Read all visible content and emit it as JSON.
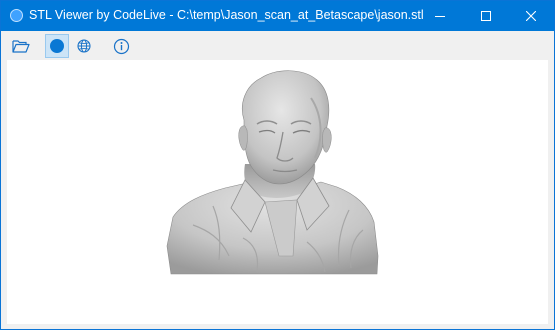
{
  "window": {
    "title": "STL Viewer by CodeLive - C:\\temp\\Jason_scan_at_Betascape\\jason.stl",
    "controls": [
      {
        "name": "minimize",
        "icon": "minimize-icon"
      },
      {
        "name": "maximize",
        "icon": "maximize-icon"
      },
      {
        "name": "close",
        "icon": "close-icon"
      }
    ]
  },
  "toolbar": {
    "buttons": [
      {
        "name": "open-file",
        "icon": "folder-open-icon"
      },
      {
        "name": "solid-view",
        "icon": "solid-sphere-icon",
        "active": true
      },
      {
        "name": "wireframe-view",
        "icon": "wireframe-globe-icon"
      },
      {
        "name": "about",
        "icon": "info-icon"
      }
    ]
  },
  "viewport": {
    "model": "3d-scan-bust",
    "background": "#ffffff"
  },
  "colors": {
    "titlebar": "#0078d7",
    "accent": "#0a74d6",
    "active_button_bg": "#cce4f7",
    "model_gray": "#c8c8c8"
  }
}
